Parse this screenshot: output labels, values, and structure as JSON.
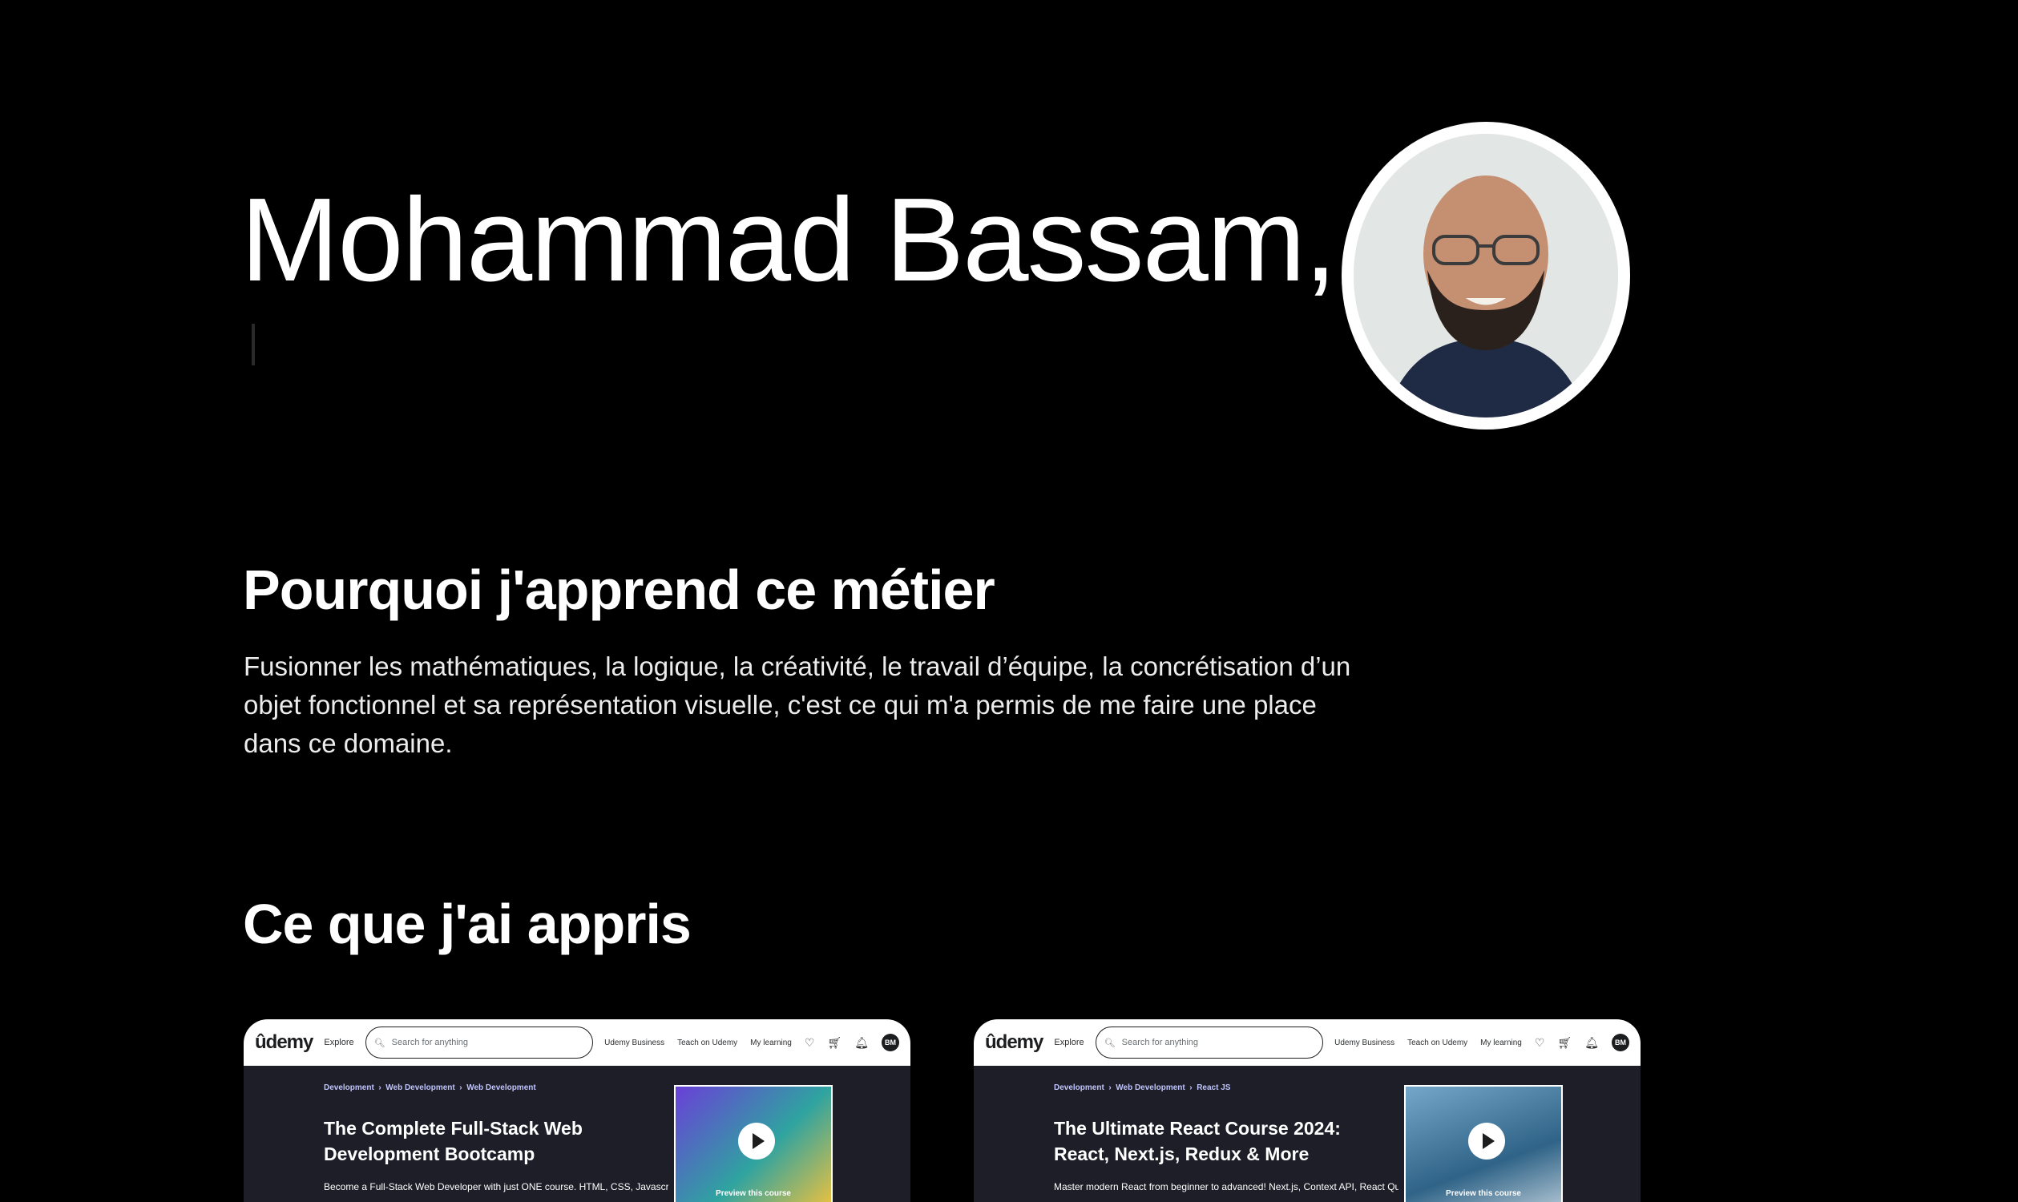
{
  "hero": {
    "name": "Mohammad Bassam,"
  },
  "why": {
    "title": "Pourquoi j'apprend ce métier",
    "text": "Fusionner les mathématiques, la logique, la créativité, le travail d’équipe, la concrétisation d’un objet fonctionnel et sa représentation visuelle, c'est ce qui m'a permis de me faire une place dans ce domaine."
  },
  "learned": {
    "title": "Ce que j'ai appris",
    "courses": [
      {
        "topbar": {
          "logo": "ûdemy",
          "explore": "Explore",
          "search_placeholder": "Search for anything",
          "business": "Udemy Business",
          "teach": "Teach on Udemy",
          "learning": "My learning",
          "initials": "BM"
        },
        "breadcrumb": [
          "Development",
          "Web Development",
          "Web Development"
        ],
        "title": "The Complete Full-Stack Web Development Bootcamp",
        "description": "Become a Full-Stack Web Developer with just ONE course. HTML, CSS, Javascript,",
        "preview": "Preview this course"
      },
      {
        "topbar": {
          "logo": "ûdemy",
          "explore": "Explore",
          "search_placeholder": "Search for anything",
          "business": "Udemy Business",
          "teach": "Teach on Udemy",
          "learning": "My learning",
          "initials": "BM"
        },
        "breadcrumb": [
          "Development",
          "Web Development",
          "React JS"
        ],
        "title": "The Ultimate React Course 2024: React, Next.js, Redux & More",
        "description": "Master modern React from beginner to advanced! Next.js, Context API, React Query,",
        "preview": "Preview this course"
      }
    ]
  },
  "icons": [
    "search-icon",
    "heart-icon",
    "cart-icon",
    "bell-icon",
    "play-icon"
  ]
}
